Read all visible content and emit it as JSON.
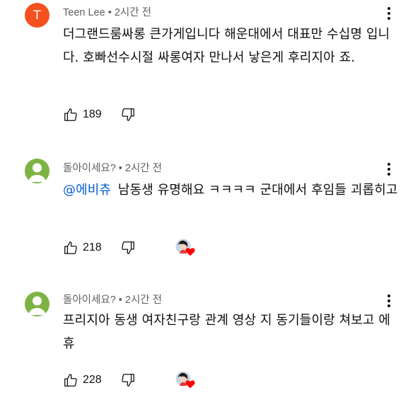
{
  "comments": [
    {
      "author": "Teen Lee",
      "time": "2시간 전",
      "avatar_letter": "T",
      "mention": "",
      "text": "더그랜드룸싸롱 큰가게입니다 해운대에서 대표만 수십명 입니다. 호빠선수시절 싸롱여자 만나서 낳은게 후리지아 죠.",
      "likes": "189",
      "creator_heart": false
    },
    {
      "author": "돌아이세요?",
      "time": "2시간 전",
      "avatar_letter": "",
      "mention": "@에비츄",
      "text": "남동생 유명해요 ㅋㅋㅋㅋ 군대에서 후임들 괴롭히고",
      "likes": "218",
      "creator_heart": true
    },
    {
      "author": "돌아이세요?",
      "time": "2시간 전",
      "avatar_letter": "",
      "mention": "",
      "text": "프리지아 동생 여자친구랑 관계 영상 지 동기들이랑 쳐보고 에휴",
      "likes": "228",
      "creator_heart": true
    }
  ],
  "separator": "•",
  "icons": {
    "like": "thumb-up-outline-icon",
    "dislike": "thumb-down-outline-icon",
    "menu": "more-vert-icon",
    "heart": "creator-heart-icon"
  },
  "colors": {
    "meta": "#606060",
    "mention": "#065fd4",
    "heart": "#ff0000",
    "avatar_orange": "#f4511e",
    "avatar_green": "#7cb342"
  }
}
